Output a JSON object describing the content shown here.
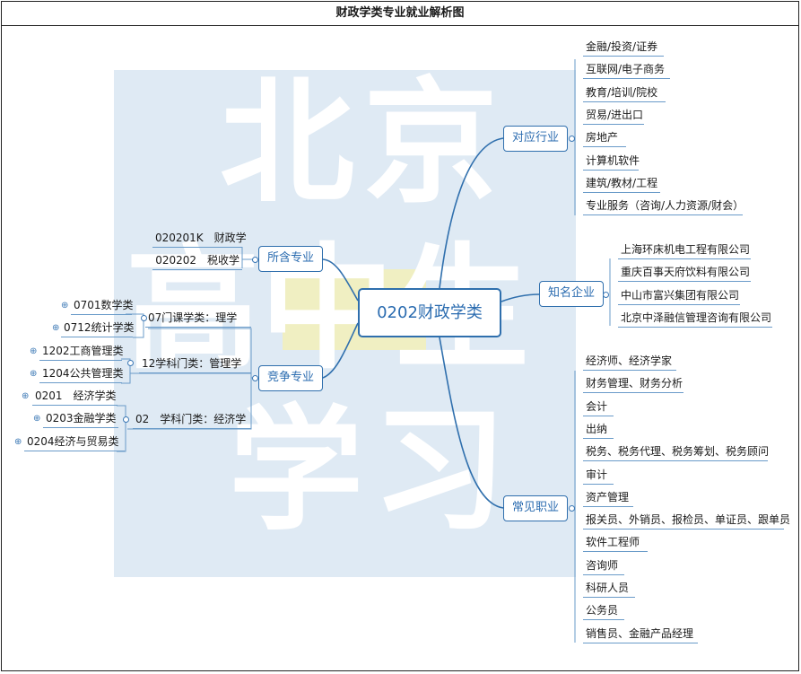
{
  "title": "财政学类专业就业解析图",
  "center": "0202财政学类",
  "watermark": {
    "line1": "北京",
    "line2": "高中生",
    "line3": "学习"
  },
  "branches": {
    "industry": {
      "label": "对应行业",
      "items": [
        "金融/投资/证券",
        "互联网/电子商务",
        "教育/培训/院校",
        "贸易/进出口",
        "房地产",
        "计算机软件",
        "建筑/教材/工程",
        "专业服务（咨询/人力资源/财会）"
      ]
    },
    "companies": {
      "label": "知名企业",
      "items": [
        "上海环床机电工程有限公司",
        "重庆百事天府饮料有限公司",
        "中山市富兴集团有限公司",
        "北京中泽融信管理咨询有限公司"
      ]
    },
    "jobs": {
      "label": "常见职业",
      "items": [
        "经济师、经济学家",
        "财务管理、财务分析",
        "会计",
        "出纳",
        "税务、税务代理、税务筹划、税务顾问",
        "审计",
        "资产管理",
        "报关员、外销员、报检员、单证员、跟单员",
        "软件工程师",
        "咨询师",
        "科研人员",
        "公务员",
        "销售员、金融产品经理"
      ]
    },
    "majors": {
      "label": "所含专业",
      "items": [
        "020201K　财政学",
        "020202　税收学"
      ]
    },
    "competing": {
      "label": "竞争专业",
      "groups": [
        {
          "label": "07门课学类：理学",
          "items": [
            "0701数学类",
            "0712统计学类"
          ]
        },
        {
          "label": "12学科门类：管理学",
          "items": [
            "1202工商管理类",
            "1204公共管理类"
          ]
        },
        {
          "label": "02　学科门类：经济学",
          "items": [
            "0201　经济学类",
            "0203金融学类",
            "0204经济与贸易类"
          ]
        }
      ]
    }
  }
}
